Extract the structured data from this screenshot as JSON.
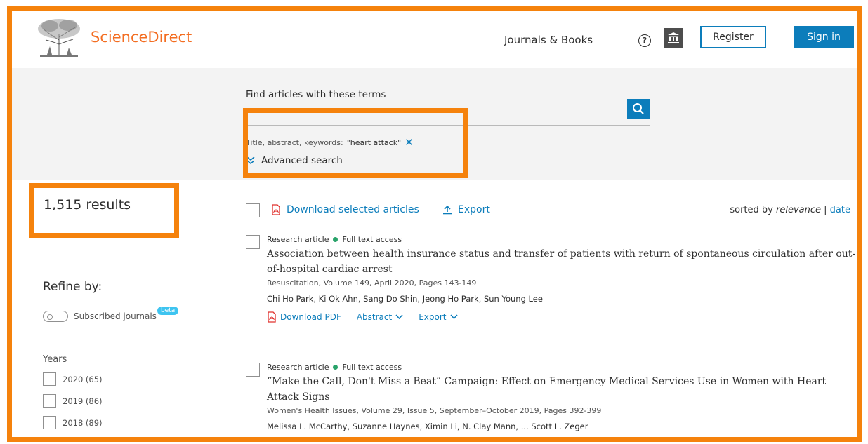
{
  "header": {
    "brand": "ScienceDirect",
    "journals_books": "Journals & Books",
    "help_glyph": "?",
    "register": "Register",
    "sign_in": "Sign in"
  },
  "search": {
    "label": "Find articles with these terms",
    "input_value": "",
    "query_prefix": "Title, abstract, keywords:",
    "query_term": "\"heart attack\"",
    "remove_glyph": "✕",
    "advanced": "Advanced search"
  },
  "sidebar": {
    "results": "1,515 results",
    "refine": "Refine by:",
    "subscribed": "Subscribed journals",
    "beta": "beta",
    "years_label": "Years",
    "years": [
      {
        "label": "2020 (65)"
      },
      {
        "label": "2019 (86)"
      },
      {
        "label": "2018 (89)"
      }
    ]
  },
  "toolbar": {
    "download_selected": "Download selected articles",
    "export": "Export",
    "sorted_by": "sorted by",
    "relevance": "relevance",
    "sep": "|",
    "date": "date"
  },
  "results": [
    {
      "type": "Research article",
      "access": "Full text access",
      "title": "Association between health insurance status and transfer of patients with return of spontaneous circulation after out-of-hospital cardiac arrest",
      "source": "Resuscitation, Volume 149, April 2020, Pages 143-149",
      "authors": "Chi Ho Park, Ki Ok Ahn, Sang Do Shin, Jeong Ho Park, Sun Young Lee",
      "download_pdf": "Download PDF",
      "abstract": "Abstract",
      "export": "Export"
    },
    {
      "type": "Research article",
      "access": "Full text access",
      "title": "“Make the Call, Don't Miss a Beat” Campaign: Effect on Emergency Medical Services Use in Women with Heart Attack Signs",
      "source": "Women's Health Issues, Volume 29, Issue 5, September–October 2019, Pages 392-399",
      "authors": "Melissa L. McCarthy, Suzanne Haynes, Ximin Li, N. Clay Mann, ... Scott L. Zeger"
    }
  ],
  "colors": {
    "accent_orange": "#f5820c",
    "brand_orange": "#f36d21",
    "link_blue": "#0c7dbb",
    "open_access_green": "#29a36a"
  }
}
